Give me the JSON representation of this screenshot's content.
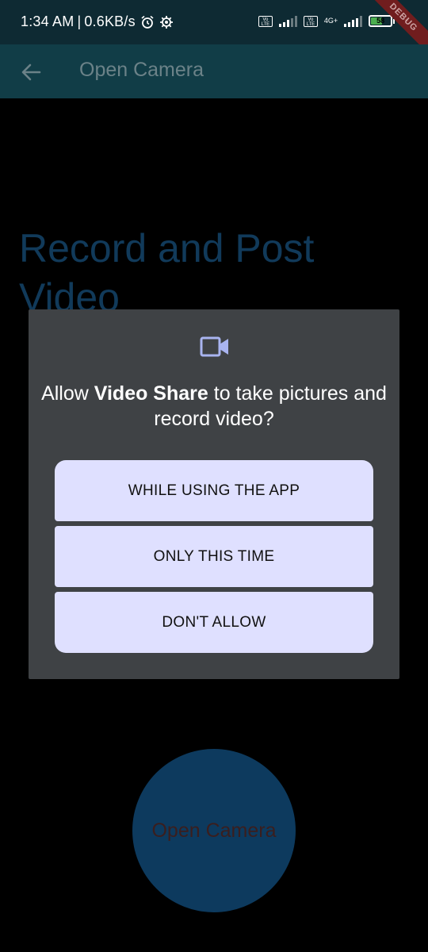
{
  "status_bar": {
    "time": "1:34 AM",
    "separator": "|",
    "speed": "0.6KB/s",
    "net_type": "4G+",
    "battery_level": "58",
    "volte_label": "Vo LTE",
    "debug_label": "DEBUG"
  },
  "app_bar": {
    "title": "Open Camera"
  },
  "page": {
    "heading": "Record and Post Video"
  },
  "dialog": {
    "message_pre": "Allow ",
    "app_name": "Video Share",
    "message_post": " to take pictures and record video?",
    "buttons": [
      "WHILE USING THE APP",
      "ONLY THIS TIME",
      "DON'T ALLOW"
    ]
  },
  "camera_button": {
    "label": "Open Camera"
  },
  "colors": {
    "status_bar": "#0e2a33",
    "app_bar": "#113d47",
    "dialog_bg": "#3f4245",
    "button_bg": "#dfe0ff",
    "accent_icon": "#a9b4f0",
    "heading": "#113a5a",
    "circle": "#0d3a5e"
  },
  "icons": {
    "back": "arrow-back-icon",
    "alarm": "alarm-clock-icon",
    "settings": "gear-icon",
    "video": "videocam-icon",
    "signal": "signal-bars-icon",
    "battery": "battery-icon",
    "charging": "bolt-icon"
  }
}
